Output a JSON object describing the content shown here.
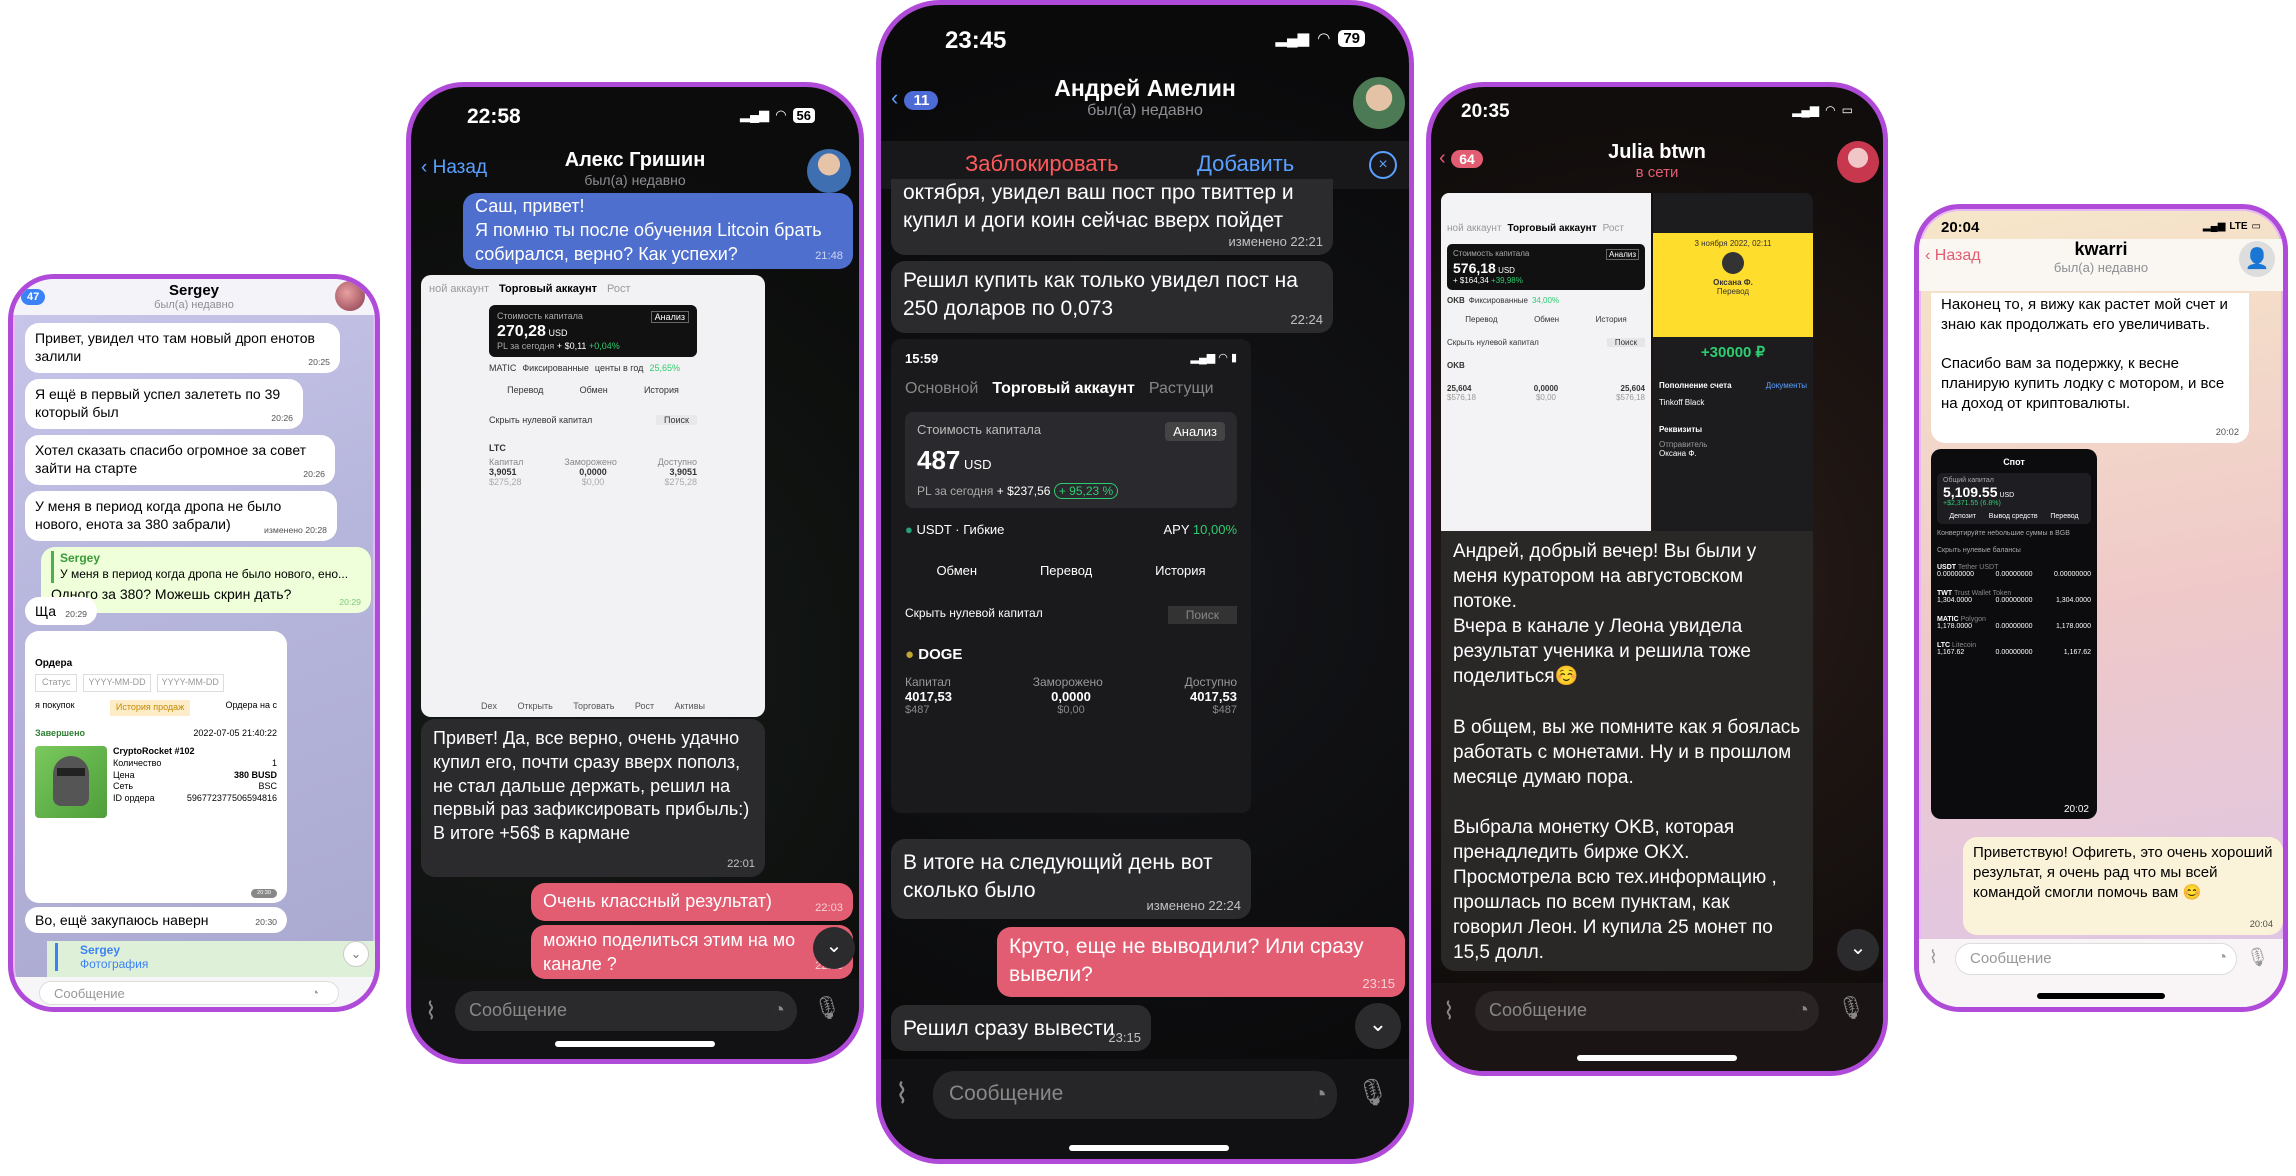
{
  "colors": {
    "frame": "#b04ad8",
    "telegram_blue": "#3b82f6",
    "mine_pink": "#e35d72",
    "dark_bubble": "#2b2b2e",
    "online": "#e35d72"
  },
  "p1": {
    "title": "Sergey",
    "status": "был(а) недавно",
    "badge": "47",
    "msgs": [
      {
        "text": "Привет, увидел что там новый дроп енотов залили",
        "time": "20:25"
      },
      {
        "text": "Я ещё в первый успел залететь по 39 который был",
        "time": "20:26"
      },
      {
        "text": "Хотел сказать спасибо огромное за совет зайти на старте",
        "time": "20:26"
      },
      {
        "text": "У меня в период когда дропа не было нового, енота за 380 забрали)",
        "time": "изменено 20:28"
      }
    ],
    "reply": {
      "name": "Sergey",
      "quote": "У меня в период когда дропа не было нового, ено...",
      "text": "Одного за 380? Можешь скрин дать?",
      "time": "20:29"
    },
    "short": {
      "text": "Ща",
      "time": "20:29"
    },
    "order": {
      "title": "Ордера",
      "status": "Статус",
      "date1": "YYYY-MM-DD",
      "date2": "YYYY-MM-DD",
      "tab1": "я покупок",
      "tab2": "История продаж",
      "tab3": "Ордера на с",
      "done": "Завершено",
      "date": "2022-07-05 21:40:22",
      "name": "CryptoRocket #102",
      "qty_l": "Количество",
      "qty": "1",
      "price_l": "Цена",
      "price": "380 BUSD",
      "net_l": "Сеть",
      "net": "BSC",
      "id_l": "ID ордера",
      "id": "596772377506594816",
      "time": "20:30"
    },
    "last": {
      "text": "Во, ещё закупаюсь наверн",
      "time": "20:30"
    },
    "reply2": {
      "name": "Sergey",
      "sub": "Фотография"
    },
    "input": "Сообщение"
  },
  "p2": {
    "time": "22:58",
    "battery": "56",
    "back": "Назад",
    "title": "Алекс Гришин",
    "status": "был(а) недавно",
    "m1": {
      "text": "Саш, привет!\nЯ помню ты после обучения Litcoin брать собирался, верно? Как успехи?",
      "time": "21:48"
    },
    "shot": {
      "tab1": "ной аккаунт",
      "tab2": "Торговый аккаунт",
      "tab3": "Рост",
      "cap_l": "Стоимость капитала",
      "an": "Анализ",
      "cap": "270,28",
      "usd": "USD",
      "pl": "PL за сегодня",
      "plv": "+ $0,11",
      "pct": "+0,04%",
      "coin": "MATIC",
      "fix": "Фиксированные",
      "rate": "центы в год",
      "ratev": "25,65%",
      "b1": "Перевод",
      "b2": "Обмен",
      "b3": "История",
      "hide": "Скрыть нулевой капитал",
      "search": "Поиск",
      "ltc": "LTC",
      "c1": "Капитал",
      "c2": "Заморожено",
      "c3": "Доступно",
      "v1": "3,9051",
      "v2": "0,0000",
      "v3": "3,9051",
      "s1": "$275,28",
      "s2": "$0,00",
      "s3": "$275,28",
      "n1": "Dex",
      "n2": "Открыть",
      "n3": "Торговать",
      "n4": "Рост",
      "n5": "Активы"
    },
    "m2": {
      "text": "Привет! Да, все верно, очень удачно купил его, почти сразу вверх пополз, не стал дальше держать, решил на первый раз зафиксировать прибыль:) В итоге +56$ в кармане",
      "time": "22:01"
    },
    "m3": {
      "text": "Очень классный результат)",
      "time": "22:03"
    },
    "m4": {
      "text": "можно поделиться этим на мо канале ?",
      "time": "22:03"
    },
    "input": "Сообщение"
  },
  "p3": {
    "time": "23:45",
    "battery": "79",
    "back": "11",
    "title": "Андрей Амелин",
    "status": "был(а) недавно",
    "block": "Заблокировать",
    "add": "Добавить",
    "m0": {
      "text": "октября, увидел ваш пост про твиттер и купил и доги коин сейчас вверх пойдет",
      "time": "изменено 22:21"
    },
    "m1": {
      "text": "Решил купить как только увидел пост на 250 доларов по 0,073",
      "time": "22:24"
    },
    "shot": {
      "time": "15:59",
      "tab1": "Основной",
      "tab2": "Торговый аккаунт",
      "tab3": "Растущи",
      "cap_l": "Стоимость капитала",
      "an": "Анализ",
      "cap": "487",
      "usd": "USD",
      "pl": "PL за сегодня",
      "plv": "+ $237,56",
      "pct": "+ 95,23 %",
      "coin": "USDT",
      "flex": "Гибкие",
      "apy": "APY",
      "apyv": "10,00%",
      "b1": "Обмен",
      "b2": "Перевод",
      "b3": "История",
      "hide": "Скрыть нулевой капитал",
      "search": "Поиск",
      "doge": "DOGE",
      "c1": "Капитал",
      "c2": "Заморожено",
      "c3": "Доступно",
      "v1": "4017,53",
      "v2": "0,0000",
      "v3": "4017,53",
      "s1": "$487",
      "s2": "$0,00",
      "s3": "$487"
    },
    "m2": {
      "text": "В итоге на следующий день вот сколько было",
      "time": "изменено 22:24"
    },
    "m3": {
      "text": "Круто, еще не выводили? Или сразу вывели?",
      "time": "23:15"
    },
    "m4": {
      "text": "Решил сразу вывести",
      "time": "23:15"
    },
    "input": "Сообщение"
  },
  "p4": {
    "time": "20:35",
    "back": "64",
    "title": "Julia btwn",
    "status": "в сети",
    "shot": {
      "tab1": "ной аккаунт",
      "tab2": "Торговый аккаунт",
      "tab3": "Рост",
      "cap_l": "Стоимость капитала",
      "an": "Анализ",
      "cap": "576,18",
      "usd": "USD",
      "plv": "+ $164,34",
      "pct": "+39,98%",
      "okb": "OKB",
      "fix": "Фиксированные",
      "ratev": "34,00%",
      "b1": "Перевод",
      "b2": "Обмен",
      "b3": "История",
      "hide": "Скрыть нулевой капитал",
      "search": "Поиск",
      "v1": "25,604",
      "v2": "0,0000",
      "v3": "25,604",
      "s1": "$576,18",
      "s2": "$0,00",
      "s3": "$576,18",
      "bank_date": "3 ноября 2022, 02:11",
      "bank_name": "Оксана Ф.",
      "bank_sub": "Перевод",
      "bank_sum": "+30000 ₽",
      "topup": "Пополнение счета",
      "docs": "Документы",
      "bank": "Tinkoff Black",
      "req": "Реквизиты",
      "sender": "Отправитель",
      "sender_v": "Оксана Ф."
    },
    "m1": {
      "text": "Андрей, добрый вечер! Вы были у меня куратором на августовском потоке.\nВчера в канале у Леона увидела результат ученика и решила тоже поделиться☺️\n\nВ общем, вы же помните как я боялась работать с монетами. Ну и в прошлом месяце думаю пора.\n\nВыбрала монетку OKB, которая пренадледить бирже OKX. Просмотрела всю тех.информацию , прошлась по всем пунктам, как говорил Леон. И купила 25 монет по 15,5 долл."
    },
    "input": "Сообщение"
  },
  "p5": {
    "time": "20:04",
    "net": "LTE",
    "back": "Назад",
    "title": "kwarri",
    "status": "был(а) недавно",
    "m1": {
      "text": "Наконец то, я вижу как растет мой счет и знаю как продолжать его увеличивать.\n\nСпасибо вам за подержку, к весне планирую купить лодку с мотором, и все на доход от криптовалюты.",
      "time": "20:02"
    },
    "shot": {
      "title": "Спот",
      "cap_l": "Общий капитал",
      "cap": "5,109.55",
      "usd": "USD",
      "pl": "+$2,371.55 (6.8%)",
      "b1": "Депозит",
      "b2": "Вывод средств",
      "b3": "Перевод",
      "conv": "Конвертируйте небольшие суммы в BGB",
      "hide": "Скрыть нулевые балансы",
      "rows": [
        {
          "n": "USDT",
          "s": "Tether USDT",
          "a": "0.00000000",
          "b": "0.00000000",
          "c": "0.00000000"
        },
        {
          "n": "TWT",
          "s": "Trust Wallet Token",
          "a": "1,304.0000",
          "b": "0.00000000",
          "c": "1,304.0000"
        },
        {
          "n": "MATIC",
          "s": "Polygon",
          "a": "1,178.0000",
          "b": "0.00000000",
          "c": "1,178.0000"
        },
        {
          "n": "LTC",
          "s": "Litecoin",
          "a": "1,167.62",
          "b": "0.00000000",
          "c": "1,167.62"
        }
      ],
      "time": "20:02"
    },
    "m2": {
      "text": "Приветствую! Офигеть, это очень хороший результат, я очень рад что мы всей командой смогли помочь вам 😊",
      "time": "20:04"
    },
    "input": "Сообщение"
  }
}
